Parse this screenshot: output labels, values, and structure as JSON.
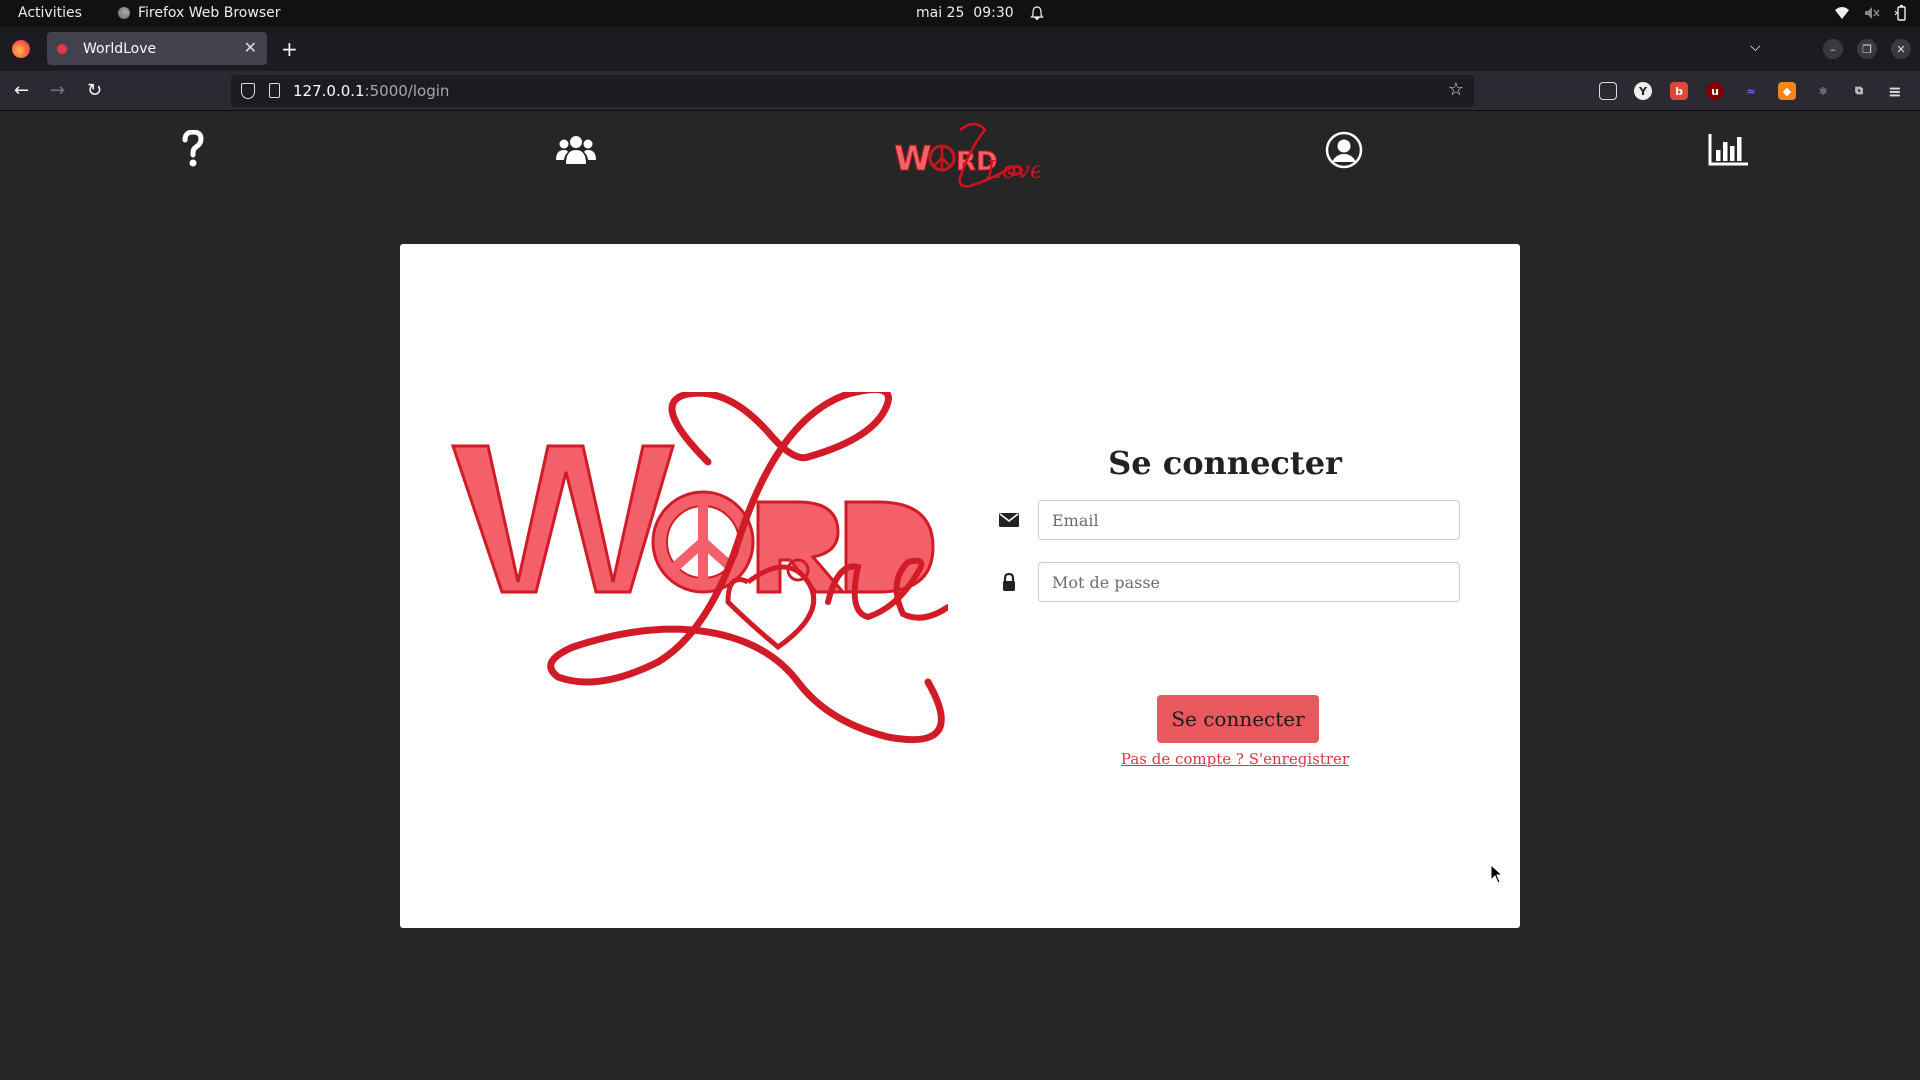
{
  "system_bar": {
    "activities": "Activities",
    "app_name": "Firefox Web Browser",
    "date": "mai 25",
    "time": "09:30"
  },
  "browser": {
    "tab_title": "WorldLove",
    "url_host": "127.0.0.1",
    "url_path": ":5000/login",
    "icons": [
      "back-icon",
      "forward-icon",
      "reload-icon",
      "shield-icon",
      "page-icon",
      "bookmark-star-icon",
      "pocket-icon",
      "extension-icon",
      "menu-icon"
    ]
  },
  "site": {
    "nav_icons": [
      "help-icon",
      "users-icon",
      "logo",
      "account-icon",
      "stats-icon"
    ],
    "logo_word": "W RD",
    "logo_script": "Love"
  },
  "login": {
    "title": "Se connecter",
    "email_placeholder": "Email",
    "password_placeholder": "Mot de passe",
    "submit_label": "Se connecter",
    "register_link": "Pas de compte ? S'enregistrer"
  },
  "colors": {
    "accent": "#e9585d",
    "link": "#dc3545",
    "background": "#262626"
  }
}
